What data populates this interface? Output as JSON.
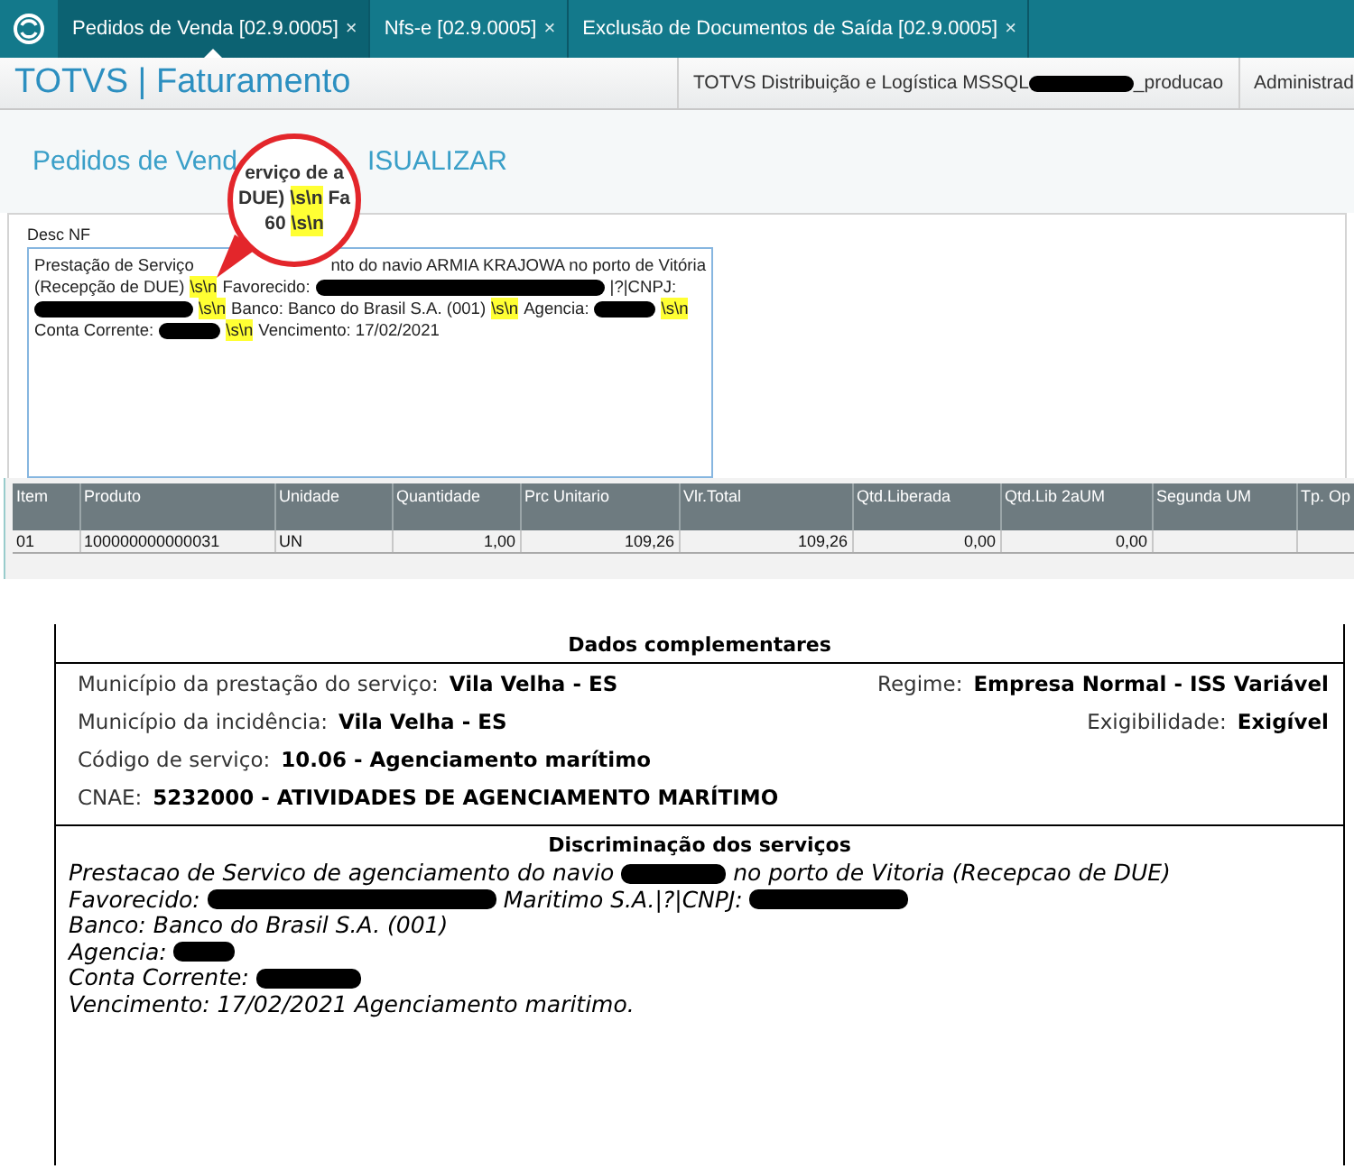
{
  "tabs": [
    {
      "label": "Pedidos de Venda [02.9.0005]",
      "close": "×",
      "selected": true
    },
    {
      "label": "Nfs-e [02.9.0005]",
      "close": "×",
      "selected": false
    },
    {
      "label": "Exclusão de Documentos de Saída [02.9.0005]",
      "close": "×",
      "selected": false
    }
  ],
  "header": {
    "app_title": "TOTVS | Faturamento",
    "environment": [
      {
        "kind": "text",
        "text": "TOTVS Distribuição e Logística MSSQL"
      },
      {
        "kind": "redaction_medium"
      },
      {
        "kind": "text",
        "text": "_producao"
      }
    ],
    "user": "Administrad"
  },
  "page_title": [
    {
      "kind": "text",
      "text": "Pedidos de Vend"
    },
    {
      "kind": "covered"
    },
    {
      "kind": "text",
      "text": "ISUALIZAR"
    }
  ],
  "desc_field": {
    "label": "Desc NF",
    "lines": [
      [
        {
          "kind": "text",
          "text": "Prestação de Serviço"
        },
        {
          "kind": "covered"
        },
        {
          "kind": "text",
          "text": "nto do navio ARMIA KRAJOWA no porto de Vitória"
        }
      ],
      [
        {
          "kind": "text",
          "text": "(Recepção de DUE)"
        },
        {
          "kind": "tag",
          "text": "\\s\\n"
        },
        {
          "kind": "text",
          "text": "Favorecido:"
        },
        {
          "kind": "redaction_xlong"
        },
        {
          "kind": "text",
          "text": "|?|CNPJ:"
        }
      ],
      [
        {
          "kind": "redaction_long"
        },
        {
          "kind": "tag",
          "text": "\\s\\n"
        },
        {
          "kind": "text",
          "text": "Banco: Banco do Brasil S.A. (001)"
        },
        {
          "kind": "tag",
          "text": "\\s\\n"
        },
        {
          "kind": "text",
          "text": "Agencia:"
        },
        {
          "kind": "redaction_short"
        },
        {
          "kind": "tag",
          "text": "\\s\\n"
        }
      ],
      [
        {
          "kind": "text",
          "text": "Conta Corrente:"
        },
        {
          "kind": "redaction_short"
        },
        {
          "kind": "tag",
          "text": "\\s\\n"
        },
        {
          "kind": "text",
          "text": "Vencimento: 17/02/2021"
        }
      ]
    ]
  },
  "magnifier": {
    "lines": [
      [
        {
          "kind": "text",
          "text": "erviço de a"
        }
      ],
      [
        {
          "kind": "text",
          "text": "DUE)"
        },
        {
          "kind": "tag",
          "text": "\\s\\n"
        },
        {
          "kind": "text",
          "text": "Fa"
        }
      ],
      [
        {
          "kind": "text",
          "text": "60"
        },
        {
          "kind": "tag",
          "text": "\\s\\n"
        }
      ]
    ]
  },
  "table": {
    "columns": [
      "Item",
      "Produto",
      "Unidade",
      "Quantidade",
      "Prc Unitario",
      "Vlr.Total",
      "Qtd.Liberada",
      "Qtd.Lib 2aUM",
      "Segunda UM",
      "Tp. Op"
    ],
    "rows": [
      [
        "01",
        "100000000000031",
        "UN",
        "1,00",
        "109,26",
        "109,26",
        "0,00",
        "0,00"
      ]
    ]
  },
  "complementary": {
    "title": "Dados complementares",
    "rows": [
      {
        "left": {
          "label": "Município da prestação do serviço:",
          "value": "Vila Velha - ES"
        },
        "right": {
          "label": "Regime:",
          "value": "Empresa Normal - ISS Variável"
        }
      },
      {
        "left": {
          "label": "Município da incidência:",
          "value": "Vila Velha - ES"
        },
        "right": {
          "label": "Exigibilidade:",
          "value": "Exigível"
        }
      },
      {
        "left": {
          "label": "Código de serviço:",
          "value": "10.06 - Agenciamento marítimo"
        }
      },
      {
        "left": {
          "label": "CNAE:",
          "value": "5232000 - ATIVIDADES DE AGENCIAMENTO MARÍTIMO"
        }
      }
    ]
  },
  "services": {
    "title": "Discriminação dos serviços",
    "lines": [
      [
        {
          "kind": "text",
          "text": "Prestacao de Servico de agenciamento do navio"
        },
        {
          "kind": "redaction_medium"
        },
        {
          "kind": "text",
          "text": "no porto de Vitoria (Recepcao de DUE)"
        }
      ],
      [
        {
          "kind": "text",
          "text": "Favorecido:"
        },
        {
          "kind": "redaction_xlong"
        },
        {
          "kind": "text",
          "text": "Maritimo S.A.|?|CNPJ:"
        },
        {
          "kind": "redaction_long"
        }
      ],
      [
        {
          "kind": "text",
          "text": "Banco: Banco do Brasil S.A. (001)"
        }
      ],
      [
        {
          "kind": "text",
          "text": "Agencia:"
        },
        {
          "kind": "redaction_short"
        }
      ],
      [
        {
          "kind": "text",
          "text": "Conta Corrente:"
        },
        {
          "kind": "redaction_medium"
        }
      ],
      [
        {
          "kind": "text",
          "text": "Vencimento: 17/02/2021 Agenciamento maritimo."
        }
      ]
    ]
  }
}
